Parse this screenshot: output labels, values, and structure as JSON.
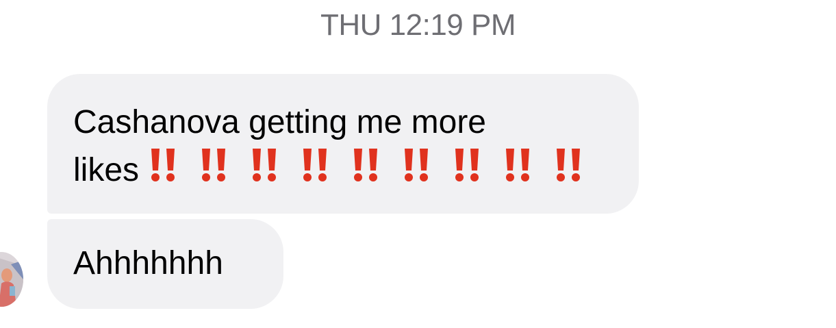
{
  "thread": {
    "timestamp": "THU 12:19 PM"
  },
  "messages": [
    {
      "text_line1": "Cashanova getting me more",
      "text_line2": "likes",
      "emoji": "double-exclamation-mark",
      "emoji_count": 9,
      "emoji_color": "#e0321e"
    },
    {
      "text": "Ahhhhhhh"
    }
  ],
  "sender": {
    "avatar": "contact-avatar"
  },
  "colors": {
    "bubble_background": "#f1f1f3",
    "timestamp_text": "#6e6e73",
    "message_text": "#000000"
  }
}
